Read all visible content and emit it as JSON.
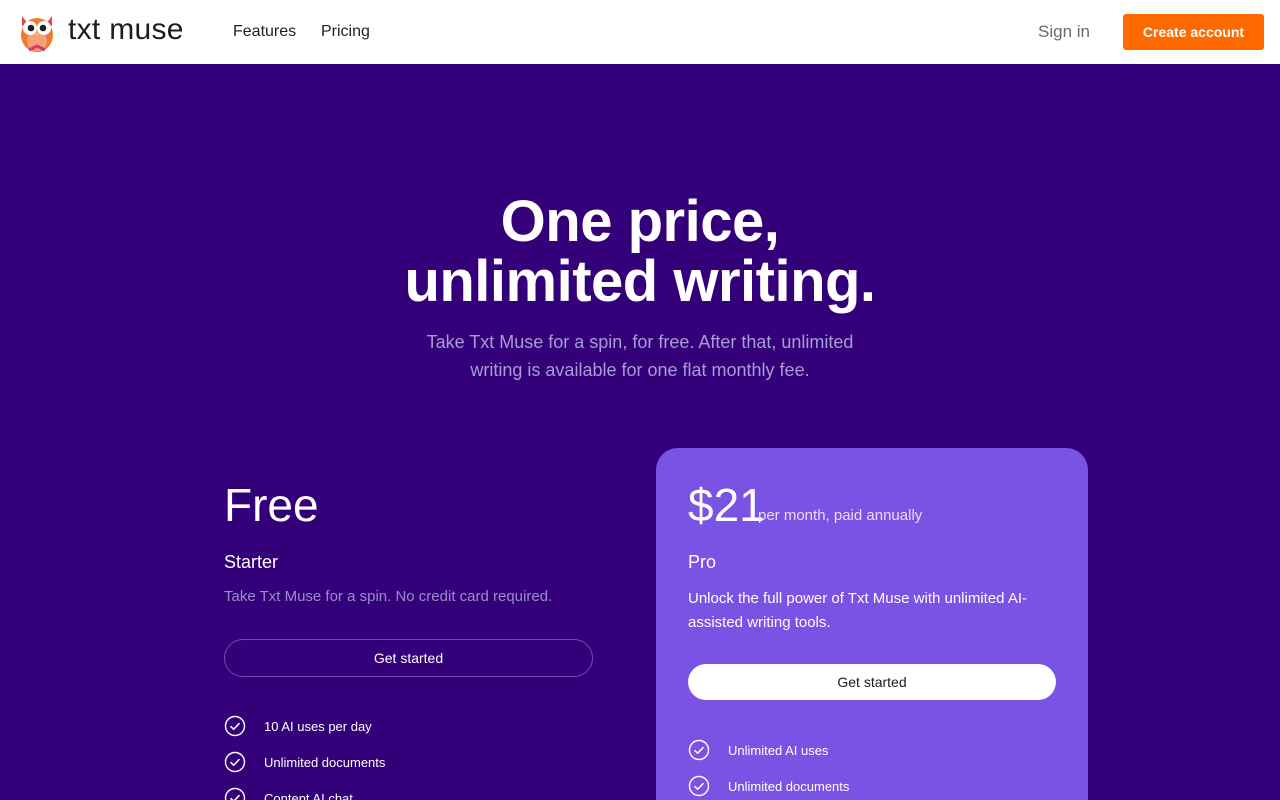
{
  "header": {
    "brand": "txt muse",
    "nav": [
      {
        "label": "Features"
      },
      {
        "label": "Pricing"
      }
    ],
    "sign_in": "Sign in",
    "create_account": "Create account",
    "accent_color": "#ff6a00"
  },
  "hero": {
    "title_line1": "One price,",
    "title_line2": "unlimited writing.",
    "subtitle": "Take Txt Muse for a spin, for free. After that, unlimited writing is available for one flat monthly fee."
  },
  "plans": {
    "free": {
      "price": "Free",
      "name": "Starter",
      "description": "Take Txt Muse for a spin. No credit card required.",
      "cta": "Get started",
      "features": [
        "10 AI uses per day",
        "Unlimited documents",
        "Content AI chat"
      ]
    },
    "pro": {
      "price": "$21",
      "price_suffix": "per month, paid annually",
      "name": "Pro",
      "description": "Unlock the full power of Txt Muse with unlimited AI-assisted writing tools.",
      "cta": "Get started",
      "features": [
        "Unlimited AI uses",
        "Unlimited documents"
      ]
    }
  },
  "colors": {
    "background": "#34007a",
    "pro_card": "#7a52e4",
    "cta": "#ff6a00"
  },
  "icons": {
    "logo": "owl-logo-icon",
    "feature_check": "check-circle-icon"
  }
}
